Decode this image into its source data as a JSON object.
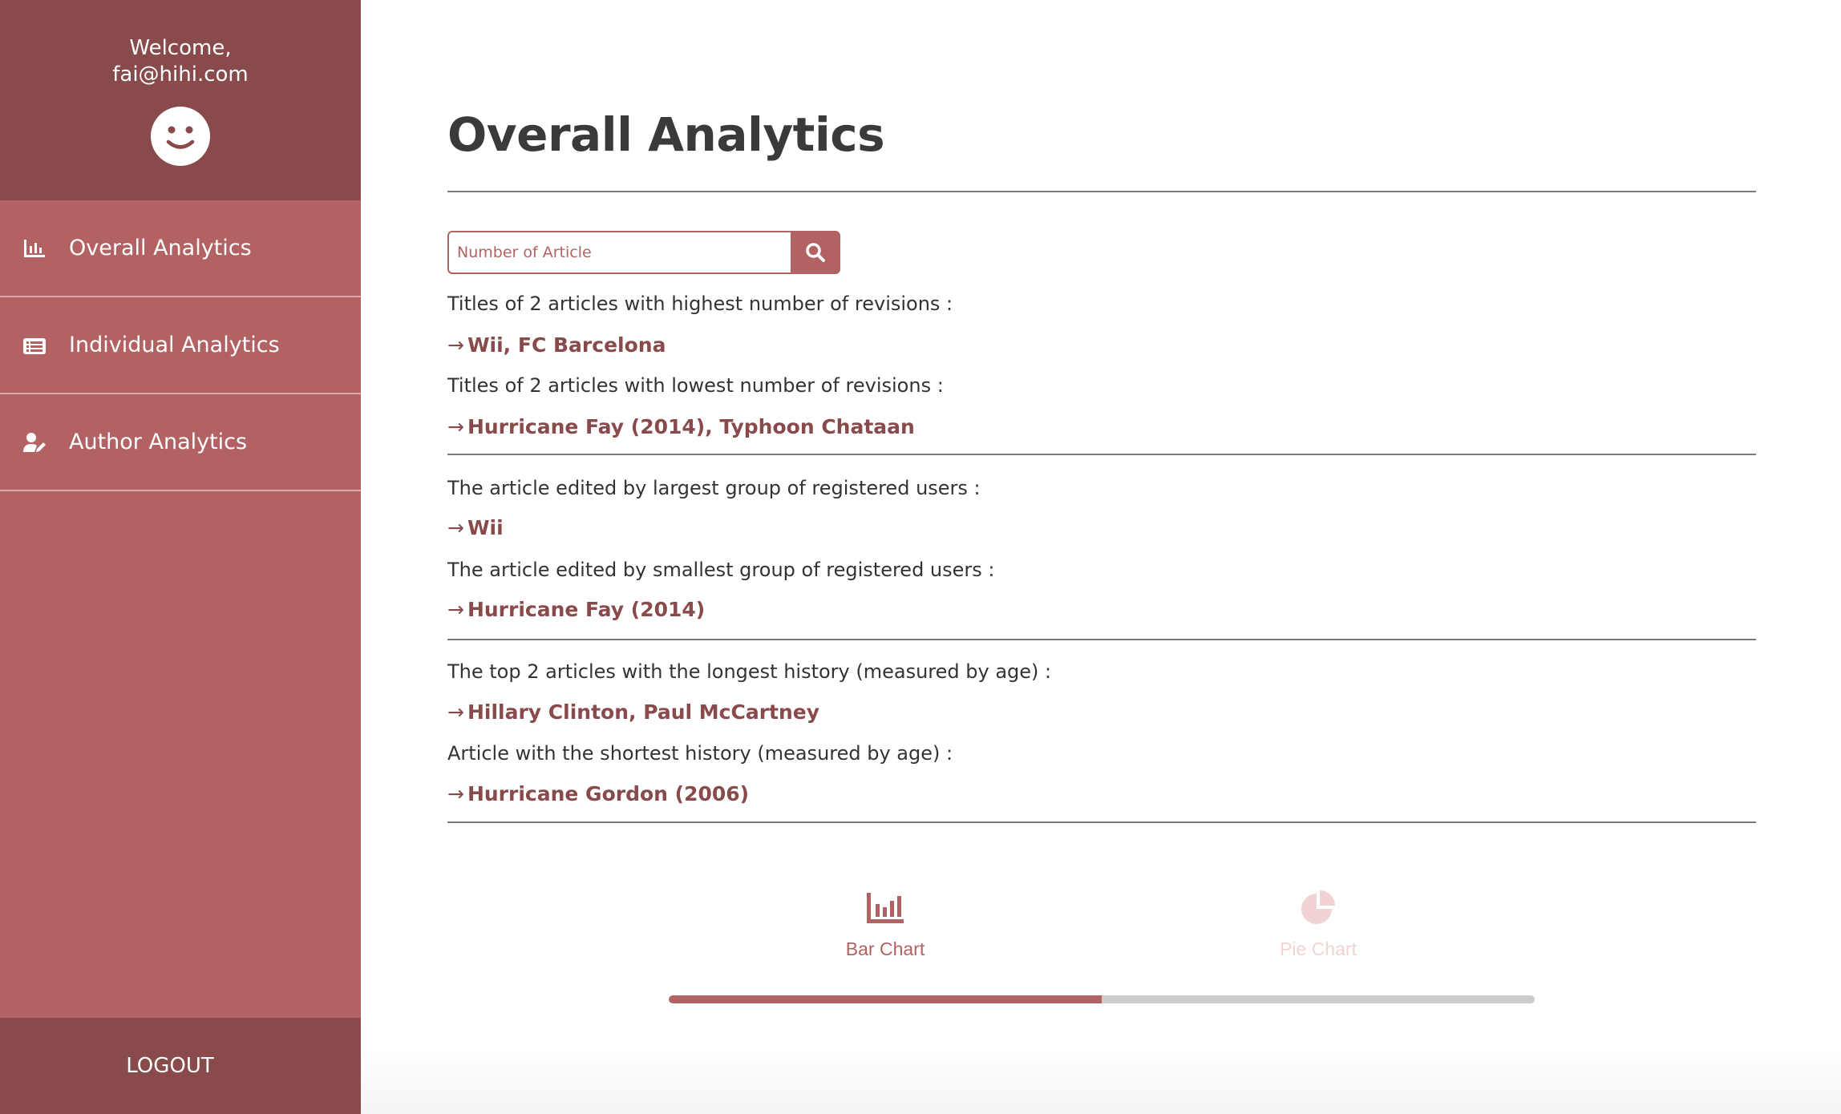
{
  "sidebar": {
    "welcome_line1": "Welcome,",
    "welcome_line2": "fai@hihi.com",
    "items": [
      {
        "label": "Overall Analytics",
        "icon": "bar-chart-icon"
      },
      {
        "label": "Individual Analytics",
        "icon": "list-alt-icon"
      },
      {
        "label": "Author Analytics",
        "icon": "user-edit-icon"
      }
    ],
    "logout_label": "LOGOUT"
  },
  "main": {
    "title": "Overall Analytics",
    "search": {
      "placeholder": "Number of Article",
      "value": ""
    },
    "stats": [
      {
        "label": "Titles of 2 articles with highest number of revisions :",
        "answer": "Wii, FC Barcelona"
      },
      {
        "label": "Titles of 2 articles with lowest number of revisions :",
        "answer": "Hurricane Fay (2014), Typhoon Chataan"
      },
      {
        "label": "The article edited by largest group of registered users :",
        "answer": "Wii"
      },
      {
        "label": "The article edited by smallest group of registered users :",
        "answer": "Hurricane Fay (2014)"
      },
      {
        "label": "The top 2 articles with the longest history (measured by age) :",
        "answer": "Hillary Clinton, Paul McCartney"
      },
      {
        "label": "Article with the shortest history (measured by age) :",
        "answer": "Hurricane Gordon (2006)"
      }
    ],
    "arrow": "→",
    "chart_tabs": [
      {
        "label": "Bar Chart",
        "icon": "bar-chart-icon",
        "active": true
      },
      {
        "label": "Pie Chart",
        "icon": "pie-chart-icon",
        "active": false
      }
    ],
    "tab_progress_fraction": 0.5
  },
  "colors": {
    "sidebar": "#b26263",
    "sidebar_dark": "#884a4b",
    "accent": "#b26263",
    "answer_text": "#884a4b",
    "inactive_tab": "#f1d3d3"
  }
}
